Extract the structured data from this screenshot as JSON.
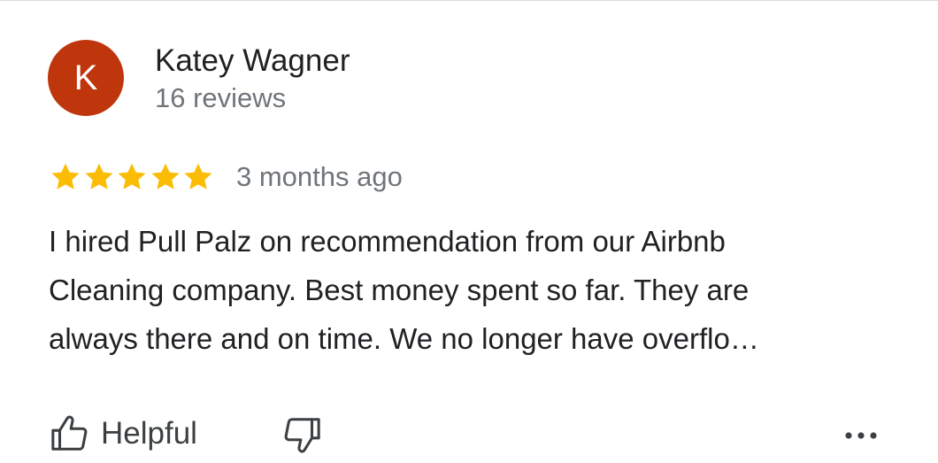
{
  "review": {
    "author": {
      "initial": "K",
      "name": "Katey Wagner",
      "reviews_count": "16 reviews",
      "avatar_color": "#c0360c"
    },
    "rating": {
      "value": 5,
      "max": 5,
      "star_color": "#fbbc04"
    },
    "time_ago": "3 months ago",
    "text_lines": [
      "I hired Pull Palz on recommendation from our Airbnb",
      "Cleaning company. Best money spent so far. They are",
      "always there and on time. We no longer have overflo…"
    ]
  },
  "actions": {
    "helpful_label": "Helpful",
    "helpful_icon": "thumbs-up-icon",
    "not_helpful_icon": "thumbs-down-icon",
    "more_icon": "more-horizontal-icon"
  }
}
